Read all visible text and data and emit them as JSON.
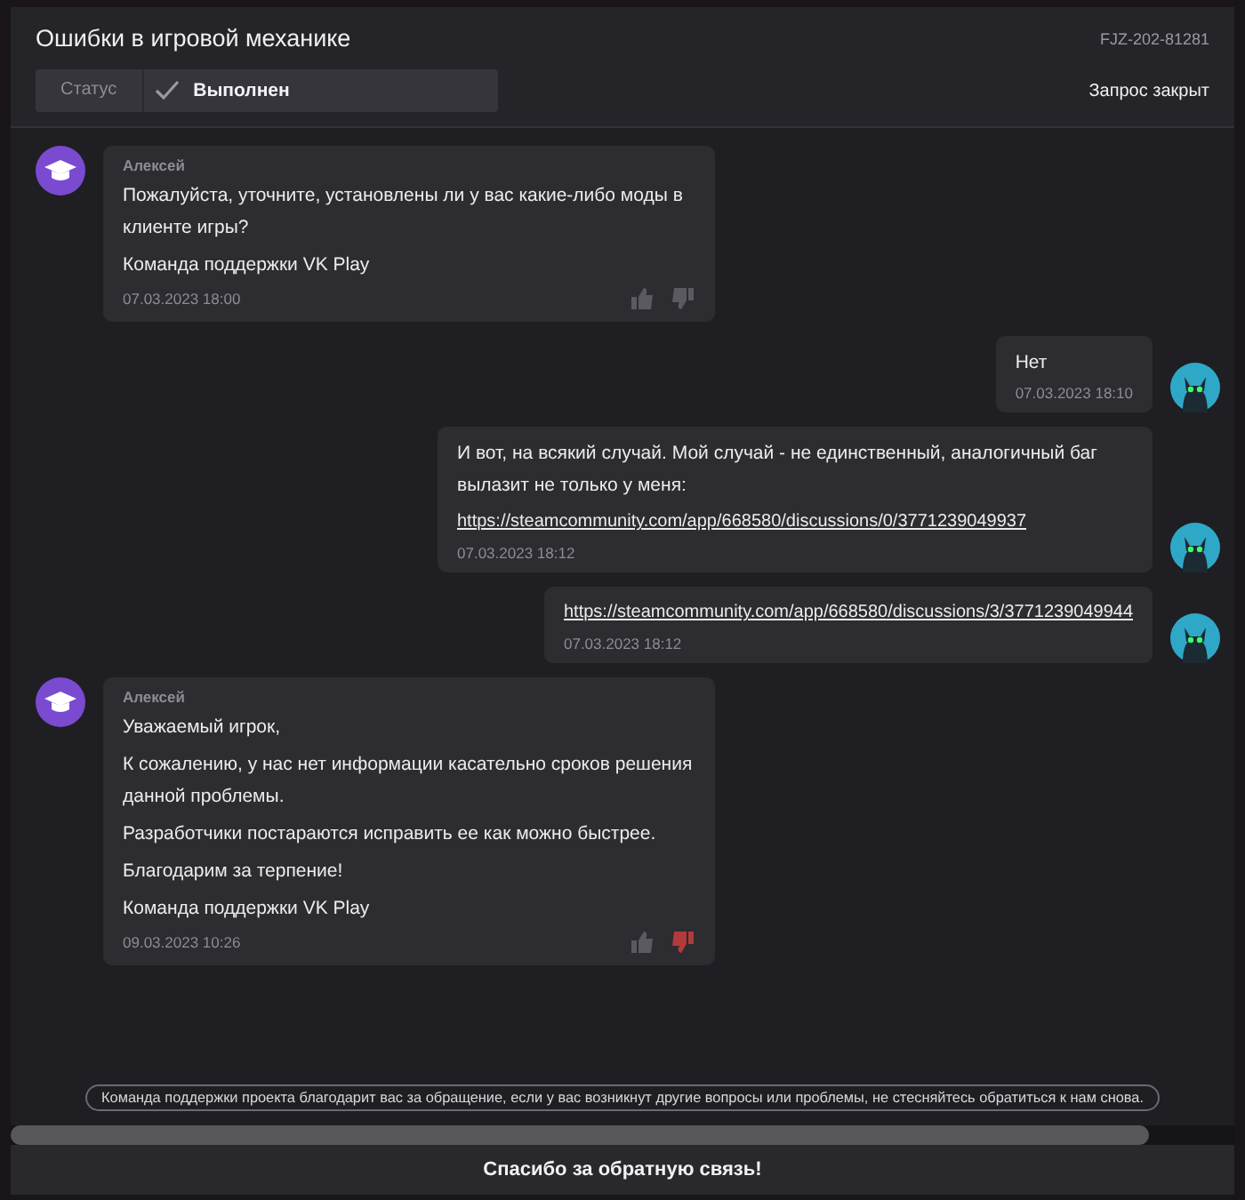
{
  "header": {
    "title": "Ошибки в игровой механике",
    "ticket_id": "FJZ-202-81281",
    "status_label": "Статус",
    "status_value": "Выполнен",
    "closed_note": "Запрос закрыт"
  },
  "messages": [
    {
      "kind": "support",
      "author": "Алексей",
      "paragraphs": [
        {
          "kind": "text",
          "text": "Пожалуйста, уточните, установлены ли у вас какие-либо моды в клиенте игры?"
        },
        {
          "kind": "text",
          "text": "Команда поддержки VK Play"
        }
      ],
      "time": "07.03.2023 18:00",
      "liked": false,
      "disliked": false
    },
    {
      "kind": "user",
      "paragraphs": [
        {
          "kind": "text",
          "text": "Нет"
        }
      ],
      "time": "07.03.2023 18:10"
    },
    {
      "kind": "user",
      "paragraphs": [
        {
          "kind": "text",
          "text": "И вот, на всякий случай. Мой случай - не единственный, аналогичный баг вылазит не только у меня:"
        },
        {
          "kind": "link",
          "text": "https://steamcommunity.com/app/668580/discussions/0/3771239049937"
        }
      ],
      "time": "07.03.2023 18:12"
    },
    {
      "kind": "user",
      "paragraphs": [
        {
          "kind": "link",
          "text": "https://steamcommunity.com/app/668580/discussions/3/3771239049944"
        }
      ],
      "time": "07.03.2023 18:12"
    },
    {
      "kind": "support",
      "author": "Алексей",
      "paragraphs": [
        {
          "kind": "text",
          "text": "Уважаемый игрок,"
        },
        {
          "kind": "text",
          "text": "К сожалению, у нас нет информации касательно сроков решения данной проблемы."
        },
        {
          "kind": "text",
          "text": "Разработчики постараются исправить ее как можно быстрее."
        },
        {
          "kind": "text",
          "text": "Благодарим за терпение!"
        },
        {
          "kind": "text",
          "text": "Команда поддержки VK Play"
        }
      ],
      "time": "09.03.2023 10:26",
      "liked": false,
      "disliked": true
    }
  ],
  "notice": "Команда поддержки проекта благодарит вас за обращение, если у вас возникнут другие вопросы или проблемы, не стесняйтесь обратиться к нам снова.",
  "footer": "Спасибо за обратную связь!"
}
